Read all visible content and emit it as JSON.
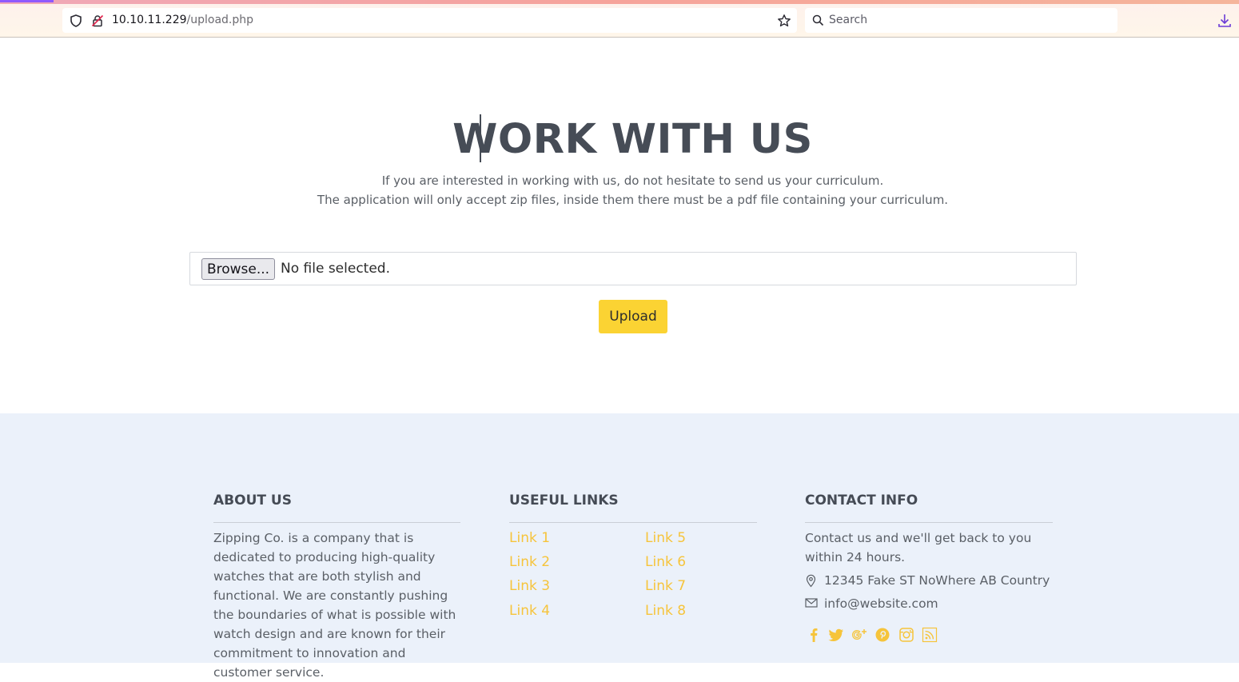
{
  "browser": {
    "url_host": "10.10.11.229",
    "url_path": "/upload.php",
    "search_placeholder": "Search"
  },
  "main": {
    "title": "WORK WITH US",
    "intro_line1": "If you are interested in working with us, do not hesitate to send us your curriculum.",
    "intro_line2": "The application will only accept zip files, inside them there must be a pdf file containing your curriculum.",
    "browse_label": "Browse...",
    "file_status": "No file selected.",
    "upload_label": "Upload"
  },
  "footer": {
    "about": {
      "heading": "ABOUT US",
      "text": "Zipping Co. is a company that is dedicated to producing high-quality watches that are both stylish and functional. We are constantly pushing the boundaries of what is possible with watch design and are known for their commitment to innovation and customer service."
    },
    "links": {
      "heading": "USEFUL LINKS",
      "items": [
        "Link 1",
        "Link 2",
        "Link 3",
        "Link 4",
        "Link 5",
        "Link 6",
        "Link 7",
        "Link 8"
      ]
    },
    "contact": {
      "heading": "CONTACT INFO",
      "text": "Contact us and we'll get back to you within 24 hours.",
      "address": "12345 Fake ST NoWhere AB Country",
      "email": "info@website.com"
    },
    "social_icons": [
      "facebook-icon",
      "twitter-icon",
      "google-plus-icon",
      "pinterest-icon",
      "instagram-icon",
      "rss-icon"
    ]
  },
  "colors": {
    "accent": "#fbd333",
    "link": "#f6c43b",
    "heading": "#464c56",
    "footer_bg": "#ebf1fa"
  }
}
